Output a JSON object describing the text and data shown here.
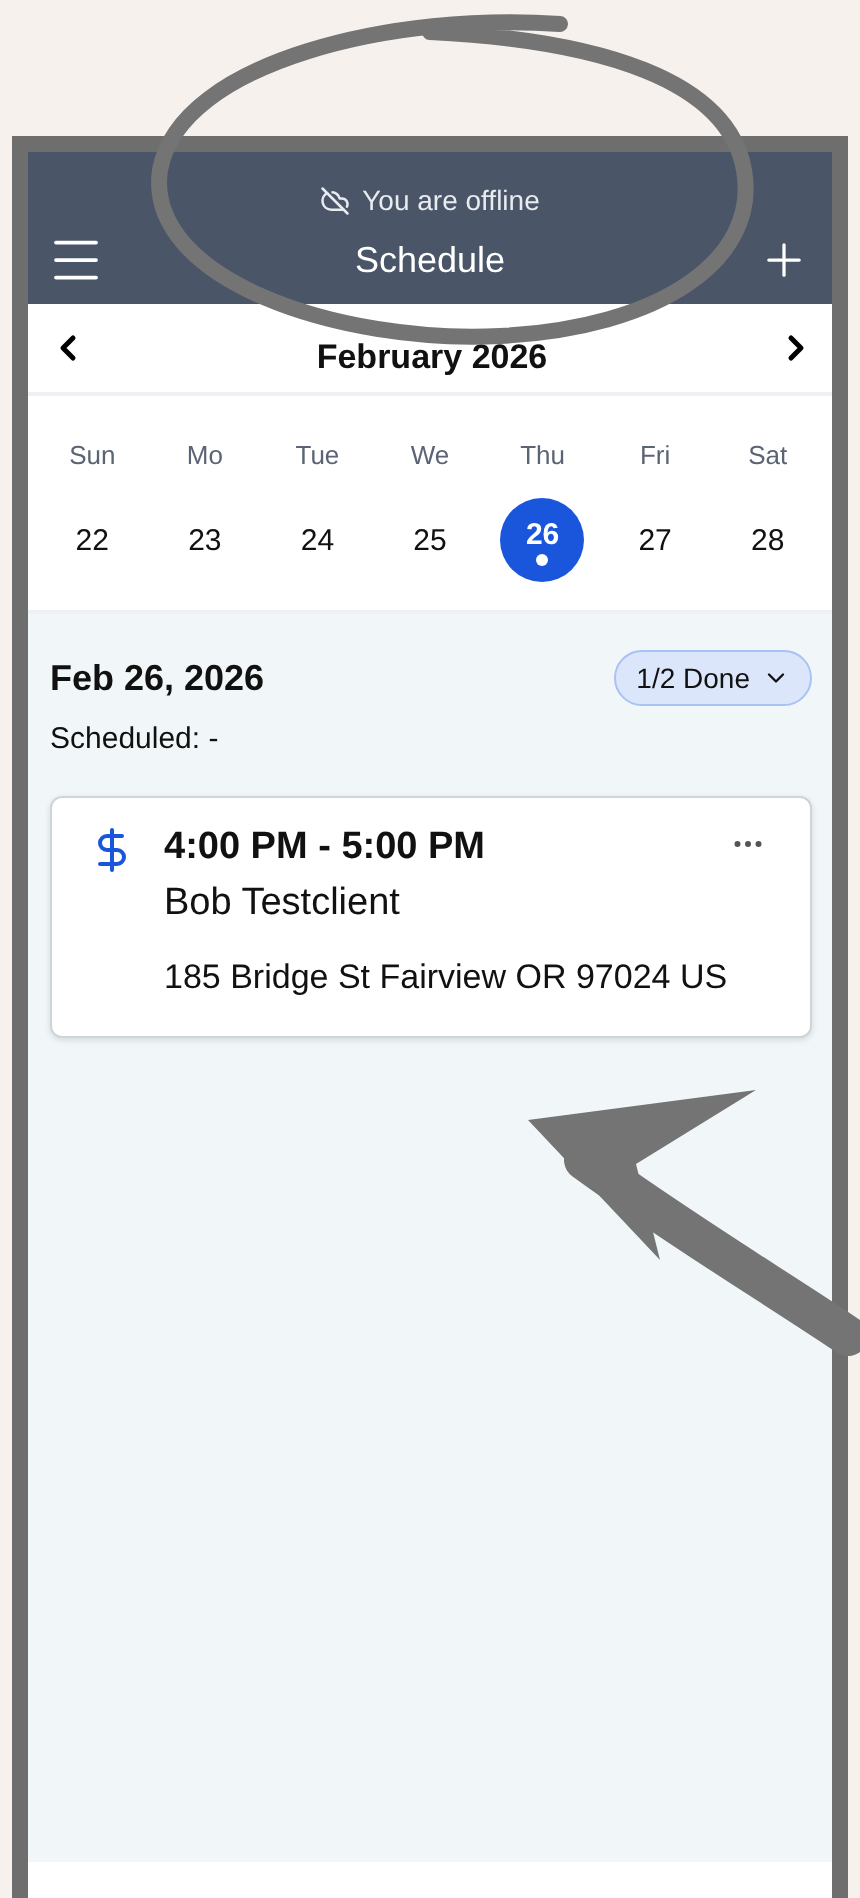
{
  "header": {
    "offline_notice": "You are offline",
    "title": "Schedule"
  },
  "month": {
    "label": "February 2026"
  },
  "week": [
    {
      "day": "Sun",
      "date": "22",
      "selected": false,
      "has_event": false
    },
    {
      "day": "Mo",
      "date": "23",
      "selected": false,
      "has_event": false
    },
    {
      "day": "Tue",
      "date": "24",
      "selected": false,
      "has_event": false
    },
    {
      "day": "We",
      "date": "25",
      "selected": false,
      "has_event": false
    },
    {
      "day": "Thu",
      "date": "26",
      "selected": true,
      "has_event": true
    },
    {
      "day": "Fri",
      "date": "27",
      "selected": false,
      "has_event": false
    },
    {
      "day": "Sat",
      "date": "28",
      "selected": false,
      "has_event": false
    }
  ],
  "summary": {
    "date": "Feb 26, 2026",
    "scheduled": "Scheduled: -",
    "progress": "1/2 Done"
  },
  "appointments": [
    {
      "time": "4:00 PM - 5:00 PM",
      "client": "Bob Testclient",
      "address": "185 Bridge St Fairview OR 97024 US"
    }
  ]
}
